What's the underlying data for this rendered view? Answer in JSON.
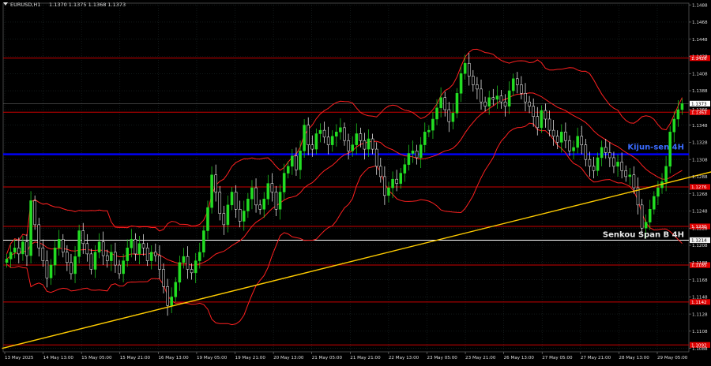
{
  "header": {
    "symbol": "EURUSD,H1",
    "quote": "1.1370 1.1375 1.1368 1.1373"
  },
  "colors": {
    "background": "#000000",
    "grid": "#1e2a2a",
    "candle_up": "#22dd22",
    "candle_down": "#ffffff",
    "level_line": "#cc0000",
    "kijun_line": "#0000ff",
    "senkou_line": "#ffffff",
    "trend_line": "#ffcc00",
    "bands": "#ff2020",
    "axis_text": "#dddddd",
    "kijun_label": "#3a6cff",
    "senkou_label": "#e8e8e8"
  },
  "chart_data": {
    "type": "candlestick",
    "symbol": "EURUSD",
    "timeframe": "H1",
    "ylim": [
      1.1084,
      1.149
    ],
    "y_ticks": [
      "1.1488",
      "1.1468",
      "1.1448",
      "1.1428",
      "1.1408",
      "1.1388",
      "1.1366",
      "1.1348",
      "1.1328",
      "1.1308",
      "1.1288",
      "1.1268",
      "1.1248",
      "1.1228",
      "1.1208",
      "1.1188",
      "1.1168",
      "1.1148",
      "1.1128",
      "1.1108",
      "1.1088"
    ],
    "x_ticks": [
      "13 May 2025",
      "14 May 13:00",
      "15 May 05:00",
      "15 May 21:00",
      "16 May 13:00",
      "19 May 05:00",
      "19 May 21:00",
      "20 May 13:00",
      "21 May 05:00",
      "21 May 21:00",
      "22 May 13:00",
      "23 May 05:00",
      "23 May 21:00",
      "26 May 13:00",
      "27 May 05:00",
      "27 May 21:00",
      "28 May 13:00",
      "29 May 05:00"
    ],
    "horizontal_levels": [
      {
        "label": "1.1426",
        "value": 1.1426,
        "style": "red"
      },
      {
        "label": "1.1363",
        "value": 1.1363,
        "style": "red"
      },
      {
        "label": "1.1276",
        "value": 1.1276,
        "style": "red"
      },
      {
        "label": "1.1230",
        "value": 1.123,
        "style": "red"
      },
      {
        "label": "1.1185",
        "value": 1.1185,
        "style": "red"
      },
      {
        "label": "1.1142",
        "value": 1.1142,
        "style": "red"
      },
      {
        "label": "1.1092",
        "value": 1.1092,
        "style": "red"
      }
    ],
    "current_price": {
      "label": "1.1373",
      "value": 1.1373
    },
    "kijun": {
      "label": "Kijun-sen 4H",
      "value": 1.1314
    },
    "senkou_b": {
      "label": "Senkou Span B 4H",
      "price_label": "1.1214",
      "value": 1.1214
    },
    "trend_line": {
      "from": [
        0,
        1.1088
      ],
      "to": [
        186,
        1.1306
      ]
    },
    "series_close": [
      1.1192,
      1.12,
      1.1205,
      1.1198,
      1.1212,
      1.1196,
      1.126,
      1.1232,
      1.1205,
      1.119,
      1.117,
      1.1185,
      1.1205,
      1.1215,
      1.12,
      1.1188,
      1.1175,
      1.1195,
      1.1225,
      1.121,
      1.1198,
      1.118,
      1.12,
      1.1212,
      1.1196,
      1.119,
      1.12,
      1.1185,
      1.1175,
      1.119,
      1.1205,
      1.1215,
      1.1198,
      1.121,
      1.1205,
      1.119,
      1.12,
      1.1196,
      1.118,
      1.116,
      1.1138,
      1.1148,
      1.1165,
      1.1188,
      1.1195,
      1.118,
      1.1176,
      1.119,
      1.12,
      1.1225,
      1.1252,
      1.129,
      1.127,
      1.1245,
      1.1232,
      1.1255,
      1.127,
      1.125,
      1.1236,
      1.1248,
      1.1262,
      1.1275,
      1.1255,
      1.125,
      1.1262,
      1.128,
      1.127,
      1.125,
      1.127,
      1.1292,
      1.13,
      1.1312,
      1.1296,
      1.1318,
      1.1348,
      1.1325,
      1.132,
      1.1338,
      1.1342,
      1.1334,
      1.1325,
      1.1335,
      1.134,
      1.1345,
      1.133,
      1.1318,
      1.1325,
      1.1338,
      1.133,
      1.132,
      1.1332,
      1.132,
      1.13,
      1.1288,
      1.1266,
      1.1275,
      1.1285,
      1.128,
      1.1292,
      1.1302,
      1.1315,
      1.1318,
      1.131,
      1.1325,
      1.134,
      1.1342,
      1.1355,
      1.1368,
      1.138,
      1.1366,
      1.1352,
      1.1362,
      1.1385,
      1.1408,
      1.142,
      1.1405,
      1.1395,
      1.139,
      1.1375,
      1.137,
      1.138,
      1.1378,
      1.1382,
      1.1375,
      1.137,
      1.1388,
      1.1402,
      1.1395,
      1.1385,
      1.1375,
      1.137,
      1.1358,
      1.1345,
      1.1365,
      1.1355,
      1.1342,
      1.1335,
      1.1328,
      1.134,
      1.133,
      1.1318,
      1.1322,
      1.1335,
      1.1325,
      1.1308,
      1.13,
      1.1295,
      1.131,
      1.1322,
      1.1316,
      1.131,
      1.13,
      1.1305,
      1.1295,
      1.1288,
      1.129,
      1.1275,
      1.1255,
      1.1228,
      1.1235,
      1.125,
      1.1265,
      1.1275,
      1.1282,
      1.13,
      1.134,
      1.1355,
      1.1366,
      1.1373
    ]
  }
}
